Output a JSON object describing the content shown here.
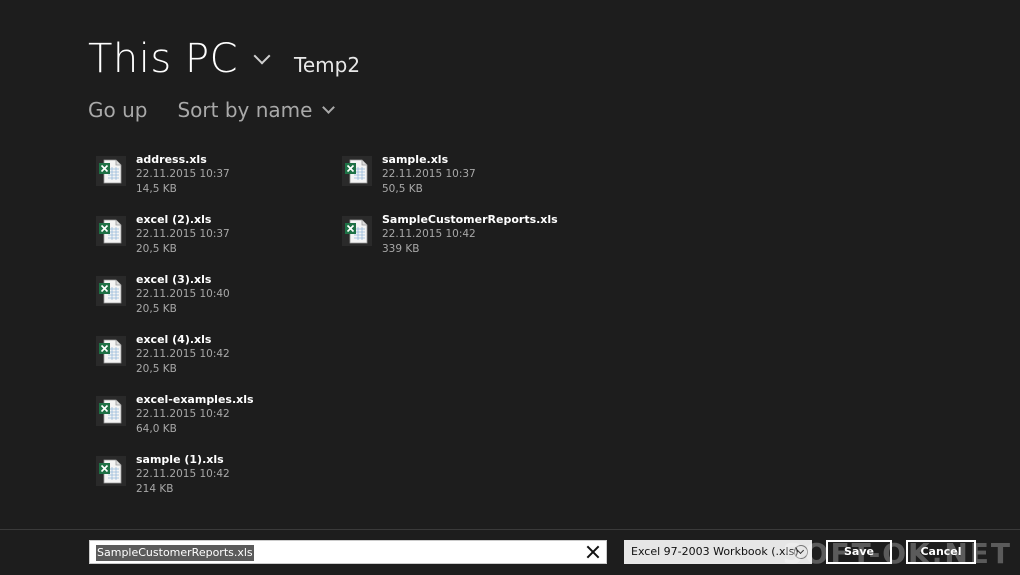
{
  "header": {
    "location": "This PC",
    "folder": "Temp2"
  },
  "toolbar": {
    "go_up": "Go up",
    "sort": "Sort by name"
  },
  "files": [
    {
      "name": "address.xls",
      "date": "22.11.2015 10:37",
      "size": "14,5 KB"
    },
    {
      "name": "excel (2).xls",
      "date": "22.11.2015 10:37",
      "size": "20,5 KB"
    },
    {
      "name": "excel (3).xls",
      "date": "22.11.2015 10:40",
      "size": "20,5 KB"
    },
    {
      "name": "excel (4).xls",
      "date": "22.11.2015 10:42",
      "size": "20,5 KB"
    },
    {
      "name": "excel-examples.xls",
      "date": "22.11.2015 10:42",
      "size": "64,0 KB"
    },
    {
      "name": "sample (1).xls",
      "date": "22.11.2015 10:42",
      "size": "214 KB"
    },
    {
      "name": "sample.xls",
      "date": "22.11.2015 10:37",
      "size": "50,5 KB"
    },
    {
      "name": "SampleCustomerReports.xls",
      "date": "22.11.2015 10:42",
      "size": "339 KB"
    }
  ],
  "footer": {
    "filename": "SampleCustomerReports.xls",
    "file_type": "Excel 97-2003 Workbook (.xls)",
    "save_label": "Save",
    "cancel_label": "Cancel"
  },
  "watermark": "SOFT-OK.NET",
  "colors": {
    "background": "#1d1d1d",
    "excel_green": "#1e7145"
  }
}
